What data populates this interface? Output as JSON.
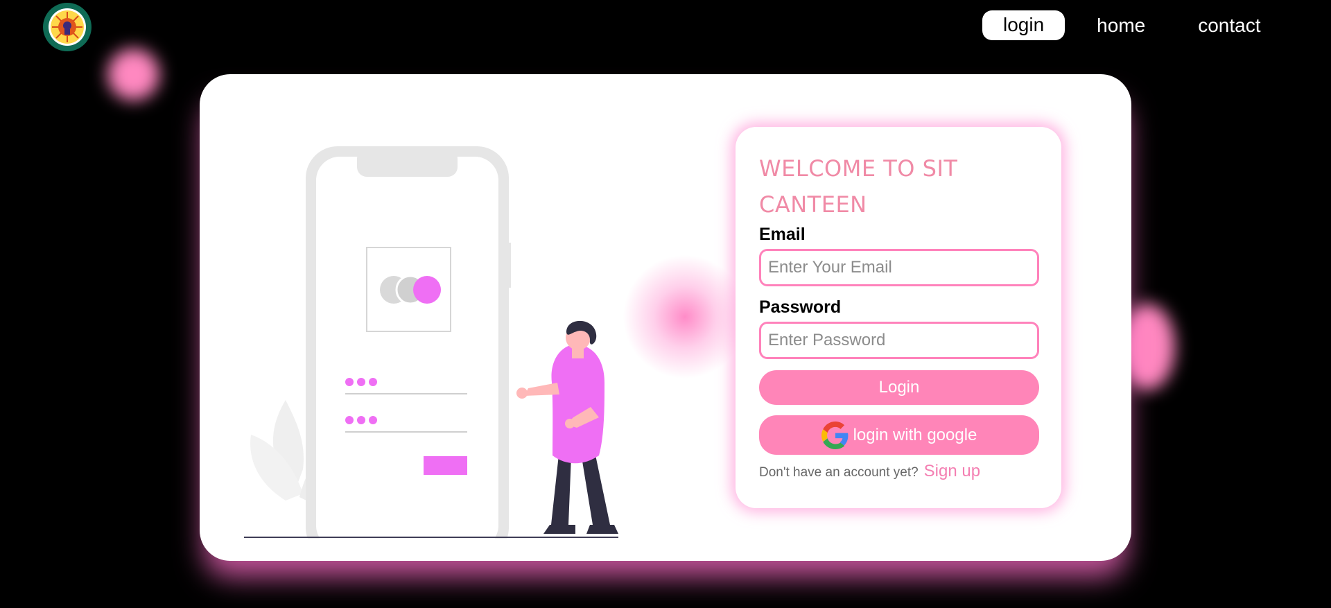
{
  "nav": {
    "login": "login",
    "home": "home",
    "contact": "contact"
  },
  "panel": {
    "title": "WELCOME TO SIT CANTEEN",
    "email_label": "Email",
    "email_placeholder": "Enter Your Email",
    "password_label": "Password",
    "password_placeholder": "Enter Password",
    "login_button": "Login",
    "google_button": "login with google",
    "signup_prompt": "Don't have an account yet?",
    "signup_link": "Sign up"
  },
  "icons": {
    "logo": "college-seal-icon",
    "google": "google-icon"
  },
  "colors": {
    "accent": "#ff85b8",
    "title": "#f08aa6",
    "illustration_accent": "#ef6ff4"
  }
}
